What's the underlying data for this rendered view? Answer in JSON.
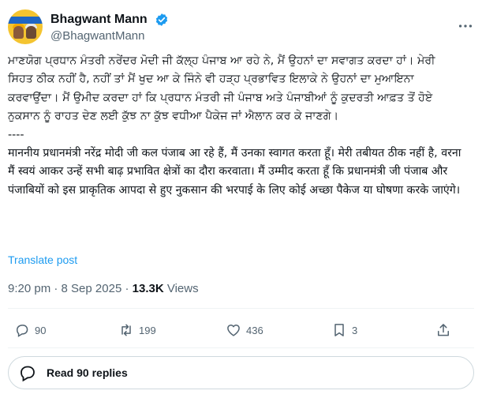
{
  "author": {
    "display_name": "Bhagwant Mann",
    "handle": "@BhagwantMann",
    "verified": true
  },
  "tweet": {
    "text_punjabi": "ਮਾਣਯੋਗ ਪ੍ਰਧਾਨ ਮੰਤਰੀ ਨਰੇਂਦਰ ਮੋਦੀ ਜੀ ਕੱਲ੍ਹ ਪੰਜਾਬ ਆ ਰਹੇ ਨੇ, ਮੈਂ ਉਹਨਾਂ ਦਾ ਸਵਾਗਤ ਕਰਦਾ ਹਾਂ। ਮੇਰੀ ਸਿਹਤ ਠੀਕ ਨਹੀਂ ਹੈ, ਨਹੀਂ ਤਾਂ ਮੈਂ ਖੁਦ ਆ ਕੇ ਜਿੰਨੇ ਵੀ ਹੜ੍ਹ ਪ੍ਰਭਾਵਿਤ ਇਲਾਕੇ ਨੇ ਉਹਨਾਂ ਦਾ ਮੁਆਇਨਾ ਕਰਵਾਉਂਦਾ। ਮੈਂ ਉਮੀਦ ਕਰਦਾ ਹਾਂ ਕਿ ਪ੍ਰਧਾਨ ਮੰਤਰੀ ਜੀ ਪੰਜਾਬ ਅਤੇ ਪੰਜਾਬੀਆਂ ਨੂੰ ਕੁਦਰਤੀ ਆਫ਼ਤ ਤੋਂ ਹੋਏ ਨੁਕਸਾਨ ਨੂੰ ਰਾਹਤ ਦੇਣ ਲਈ ਕੁੱਝ ਨਾ ਕੁੱਝ ਵਧੀਆ ਪੈਕੇਜ ਜਾਂ ਐਲਾਨ ਕਰ ਕੇ ਜਾਣਗੇ।",
    "separator": "----",
    "text_hindi": "माननीय प्रधानमंत्री नरेंद्र मोदी जी कल पंजाब आ रहे हैं, मैं उनका स्वागत करता हूँ। मेरी तबीयत ठीक नहीं है, वरना मैं स्वयं आकर उन्हें सभी बाढ़ प्रभावित क्षेत्रों का दौरा करवाता। मैं उम्मीद करता हूँ कि प्रधानमंत्री जी पंजाब और पंजाबियों को इस प्राकृतिक आपदा से हुए नुकसान की भरपाई के लिए कोई अच्छा पैकेज या घोषणा करके जाएंगे।",
    "translate_label": "Translate post",
    "time": "9:20 pm",
    "dot": "·",
    "date": "8 Sep 2025",
    "dot2": "·",
    "views_count": "13.3K",
    "views_label": "Views"
  },
  "actions": {
    "replies": "90",
    "reposts": "199",
    "likes": "436",
    "bookmarks": "3"
  },
  "read_replies_label": "Read 90 replies",
  "colors": {
    "accent": "#1d9bf0",
    "secondary_text": "#536471",
    "primary_text": "#0f1419"
  }
}
